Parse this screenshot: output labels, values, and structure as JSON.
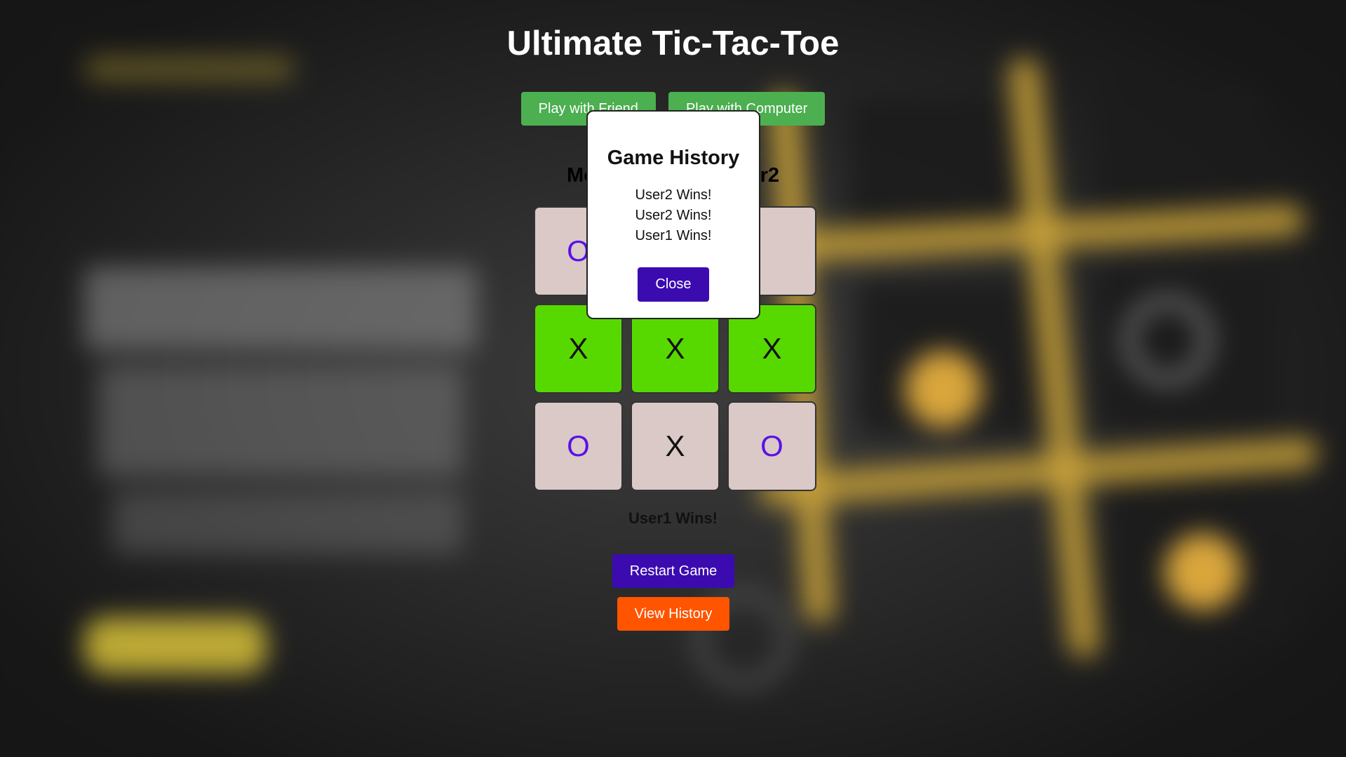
{
  "app": {
    "title": "Ultimate Tic-Tac-Toe"
  },
  "modes": [
    {
      "label": "Play with Friend"
    },
    {
      "label": "Play with Computer"
    }
  ],
  "status": {
    "mode_players_text": "Mode: User1 vs User2"
  },
  "board": {
    "cells": [
      {
        "mark": "O",
        "win": false
      },
      {
        "mark": "",
        "win": false
      },
      {
        "mark": "",
        "win": false
      },
      {
        "mark": "X",
        "win": true
      },
      {
        "mark": "X",
        "win": true
      },
      {
        "mark": "X",
        "win": true
      },
      {
        "mark": "O",
        "win": false
      },
      {
        "mark": "X",
        "win": false
      },
      {
        "mark": "O",
        "win": false
      }
    ]
  },
  "result": {
    "text": "User1 Wins!"
  },
  "actions": {
    "restart_label": "Restart Game",
    "history_label": "View History"
  },
  "modal": {
    "title": "Game History",
    "entries": [
      "User2 Wins!",
      "User2 Wins!",
      "User1 Wins!"
    ],
    "close_label": "Close"
  },
  "colors": {
    "mode_button": "#4caf50",
    "win_cell": "#57d900",
    "cell": "#dac9c7",
    "o_mark": "#5a10e8",
    "restart_button": "#3b0bb0",
    "history_button": "#ff5500"
  }
}
